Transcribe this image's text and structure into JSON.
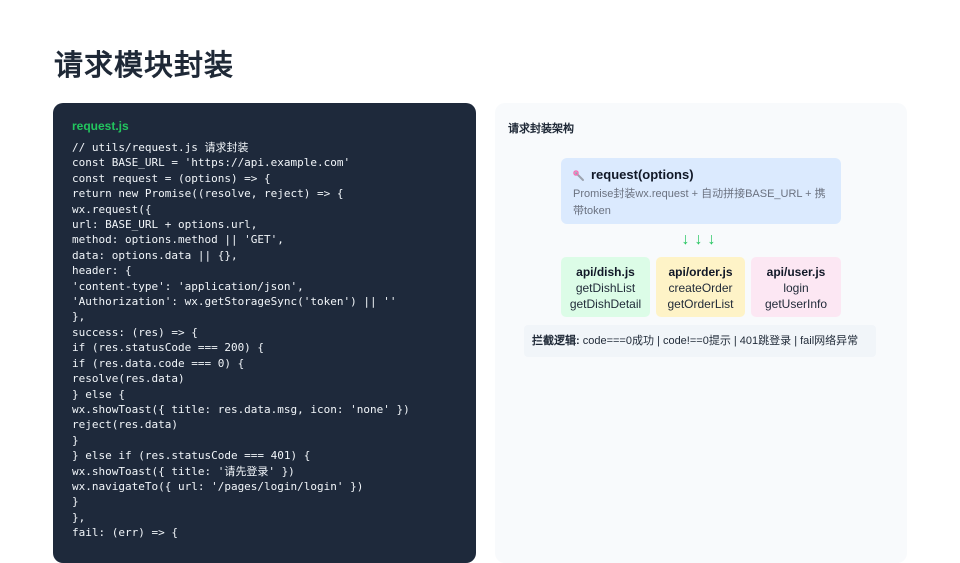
{
  "page": {
    "title": "请求模块封装"
  },
  "code": {
    "filename": "request.js",
    "lines": [
      "// utils/request.js 请求封装",
      "const BASE_URL = 'https://api.example.com'",
      "const request = (options) => {",
      "return new Promise((resolve, reject) => {",
      "wx.request({",
      "url: BASE_URL + options.url,",
      "method: options.method || 'GET',",
      "data: options.data || {},",
      "header: {",
      "'content-type': 'application/json',",
      "'Authorization': wx.getStorageSync('token') || ''",
      "},",
      "success: (res) => {",
      "if (res.statusCode === 200) {",
      "if (res.data.code === 0) {",
      "resolve(res.data)",
      "} else {",
      "wx.showToast({ title: res.data.msg, icon: 'none' })",
      "reject(res.data)",
      "}",
      "} else if (res.statusCode === 401) {",
      "wx.showToast({ title: '请先登录' })",
      "wx.navigateTo({ url: '/pages/login/login' })",
      "}",
      "},",
      "fail: (err) => {"
    ]
  },
  "architecture": {
    "title": "请求封装架构",
    "request": {
      "icon": "wrench-icon",
      "name": "request(options)",
      "description": "Promise封装wx.request + 自动拼接BASE_URL + 携带token"
    },
    "arrows": "↓↓↓",
    "apis": [
      {
        "name": "api/dish.js",
        "functions": [
          "getDishList",
          "getDishDetail"
        ]
      },
      {
        "name": "api/order.js",
        "functions": [
          "createOrder",
          "getOrderList"
        ]
      },
      {
        "name": "api/user.js",
        "functions": [
          "login",
          "getUserInfo"
        ]
      }
    ],
    "note": {
      "label": "拦截逻辑:",
      "text": "code===0成功 | code!==0提示 | 401跳登录 | fail网络异常"
    }
  },
  "colors": {
    "code_background": "#1e293b",
    "filename_accent": "#22c55e",
    "request_box": "#dbeafe",
    "dish_box": "#dcfce7",
    "order_box": "#fef3c7",
    "user_box": "#fce7f3"
  }
}
